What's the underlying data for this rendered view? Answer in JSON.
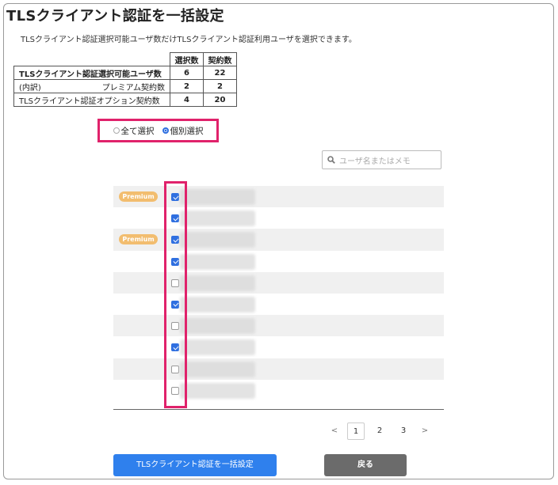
{
  "page": {
    "title": "TLSクライアント認証を一括設定",
    "description": "TLSクライアント認証選択可能ユーザ数だけTLSクライアント認証利用ユーザを選択できます。"
  },
  "summary": {
    "headers": [
      "選択数",
      "契約数"
    ],
    "rows": [
      {
        "label": "TLSクライアント認証選択可能ユーザ数",
        "selected": "6",
        "contracted": "22"
      },
      {
        "prefix": "(内訳)",
        "label": "プレミアム契約数",
        "selected": "2",
        "contracted": "2"
      },
      {
        "label": "TLSクライアント認証オプション契約数",
        "selected": "4",
        "contracted": "20"
      }
    ]
  },
  "selection_mode": {
    "options": [
      "全て選択",
      "個別選択"
    ],
    "selected": "個別選択"
  },
  "search": {
    "placeholder": "ユーザ名またはメモ"
  },
  "users": [
    {
      "premium": true,
      "checked": true
    },
    {
      "premium": false,
      "checked": true
    },
    {
      "premium": true,
      "checked": true
    },
    {
      "premium": false,
      "checked": true
    },
    {
      "premium": false,
      "checked": false
    },
    {
      "premium": false,
      "checked": true
    },
    {
      "premium": false,
      "checked": false
    },
    {
      "premium": false,
      "checked": true
    },
    {
      "premium": false,
      "checked": false
    },
    {
      "premium": false,
      "checked": false
    }
  ],
  "premium_badge": "Premium",
  "pagination": {
    "prev": "<",
    "pages": [
      "1",
      "2",
      "3"
    ],
    "current": "1",
    "next": ">"
  },
  "buttons": {
    "apply": "TLSクライアント認証を一括設定",
    "back": "戻る"
  },
  "colors": {
    "accent": "#2f80ed",
    "highlight": "#e0226b",
    "premium": "#f2bd6f",
    "back_button": "#6b6b6b"
  },
  "icons": {
    "search": "magnifier-icon"
  }
}
